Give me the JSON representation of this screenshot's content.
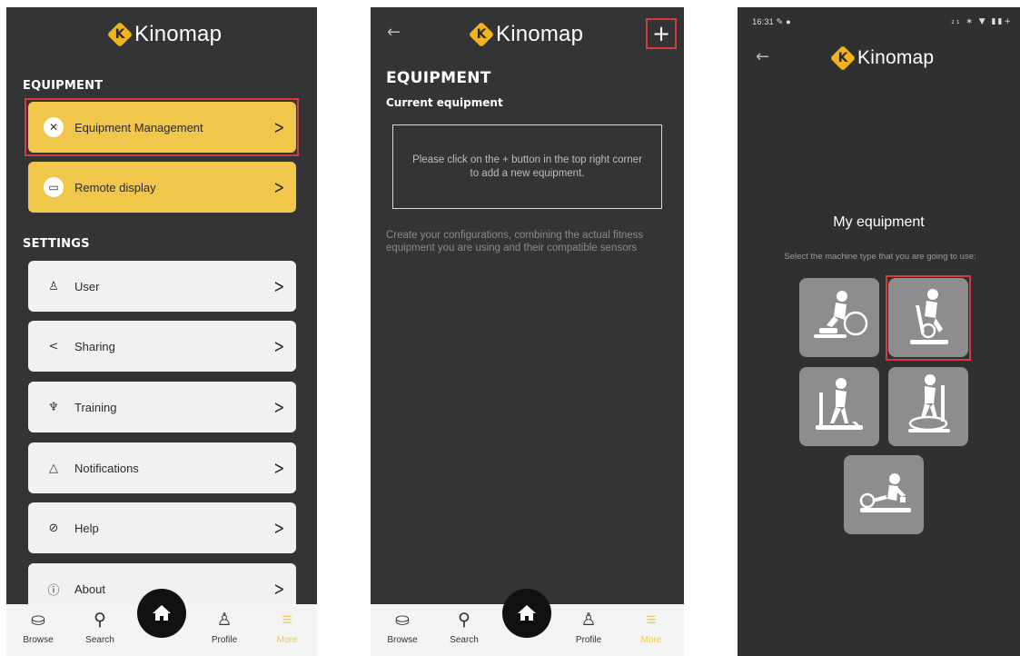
{
  "brand": {
    "name": "Kinomap",
    "mark_letter": "K",
    "accent_color": "#f2b41c"
  },
  "screen1": {
    "sections": [
      {
        "label": "EQUIPMENT"
      },
      {
        "label": "SETTINGS"
      }
    ],
    "items": [
      {
        "label": "Equipment Management",
        "icon": "wrench-screwdriver-icon",
        "style": "yellow",
        "highlighted": true
      },
      {
        "label": "Remote display",
        "icon": "monitor-icon",
        "style": "yellow"
      },
      {
        "label": "User",
        "icon": "user-icon",
        "style": "white"
      },
      {
        "label": "Sharing",
        "icon": "share-icon",
        "style": "white"
      },
      {
        "label": "Training",
        "icon": "trophy-icon",
        "style": "white"
      },
      {
        "label": "Notifications",
        "icon": "bell-icon",
        "style": "white"
      },
      {
        "label": "Help",
        "icon": "help-circle-icon",
        "style": "white"
      },
      {
        "label": "About",
        "icon": "info-icon",
        "style": "white"
      }
    ]
  },
  "nav": {
    "items": [
      {
        "label": "Browse",
        "icon": "browse-icon"
      },
      {
        "label": "Search",
        "icon": "search-icon"
      },
      {
        "label": "Profile",
        "icon": "profile-icon"
      },
      {
        "label": "More",
        "icon": "menu-icon",
        "active": true
      }
    ],
    "home_icon": "home-icon"
  },
  "screen2": {
    "title": "EQUIPMENT",
    "subtitle": "Current equipment",
    "empty_message": "Please click on the + button in the top right corner to add a new equipment.",
    "hint": "Create your configurations, combining the actual fitness equipment you are using and their compatible sensors",
    "add_label": "+"
  },
  "screen3": {
    "status_time": "16:31",
    "status_left_icons": "✎ ●",
    "status_right_icons": "₂₁ ∗ ▼ ▮▮+",
    "title": "My equipment",
    "subtitle": "Select the machine type that you are going to use:",
    "machines": [
      {
        "name": "Bike trainer",
        "icon": "bike-trainer-icon"
      },
      {
        "name": "Exercise bike",
        "icon": "exercise-bike-icon",
        "highlighted": true
      },
      {
        "name": "Treadmill",
        "icon": "treadmill-icon"
      },
      {
        "name": "Elliptical",
        "icon": "elliptical-icon"
      },
      {
        "name": "Rower",
        "icon": "rower-icon"
      }
    ]
  },
  "colors": {
    "highlight": "#d73b3b",
    "yellow_button": "#f0c64b",
    "background": "#333436"
  }
}
